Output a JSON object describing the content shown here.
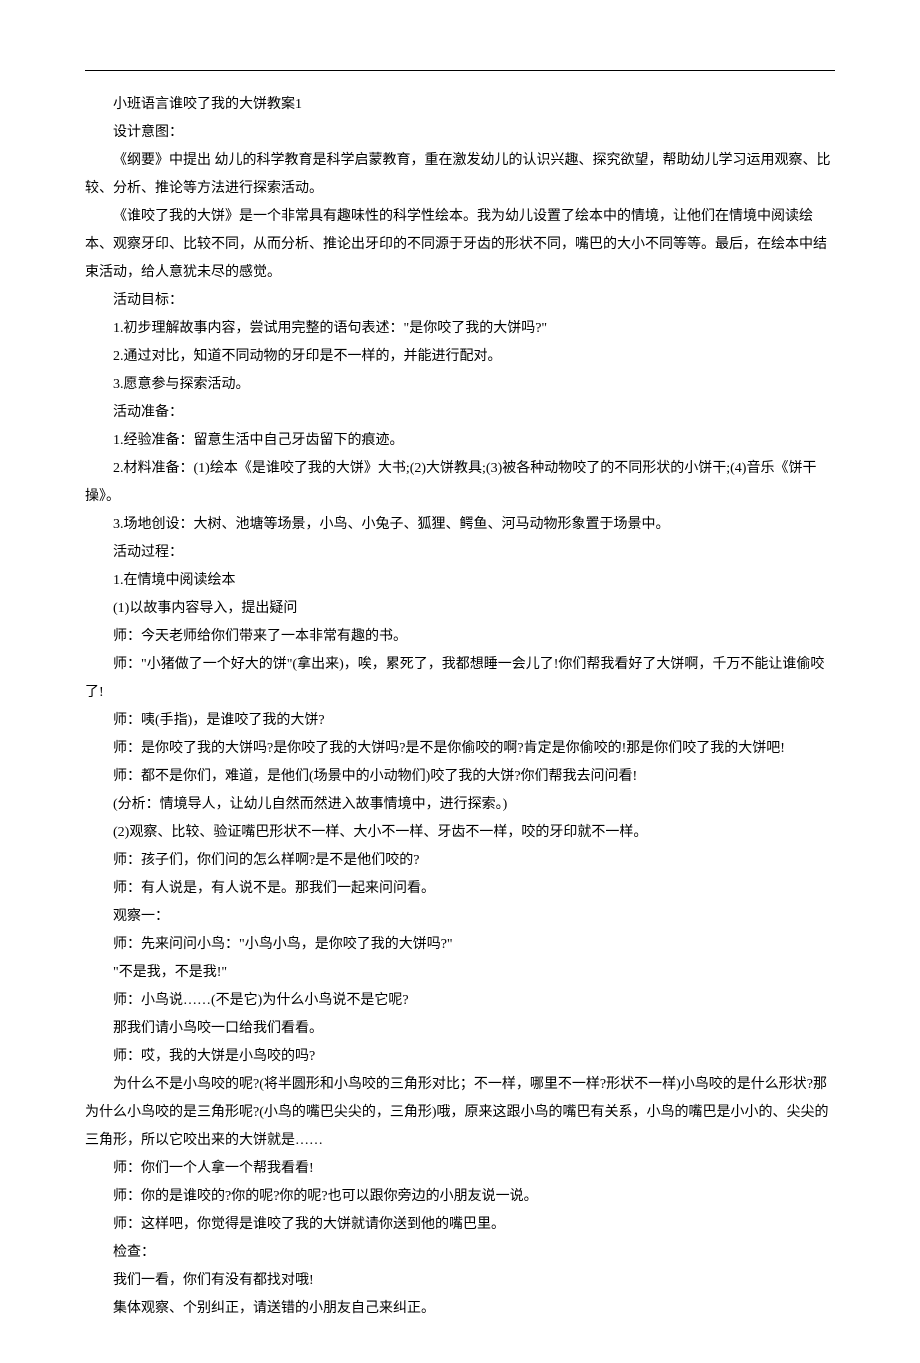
{
  "lines": [
    "小班语言谁咬了我的大饼教案1",
    "设计意图：",
    "《纲要》中提出 幼儿的科学教育是科学启蒙教育，重在激发幼儿的认识兴趣、探究欲望，帮助幼儿学习运用观察、比较、分析、推论等方法进行探索活动。",
    "《谁咬了我的大饼》是一个非常具有趣味性的科学性绘本。我为幼儿设置了绘本中的情境，让他们在情境中阅读绘本、观察牙印、比较不同，从而分析、推论出牙印的不同源于牙齿的形状不同，嘴巴的大小不同等等。最后，在绘本中结束活动，给人意犹未尽的感觉。",
    "活动目标：",
    "1.初步理解故事内容，尝试用完整的语句表述：\"是你咬了我的大饼吗?\"",
    "2.通过对比，知道不同动物的牙印是不一样的，并能进行配对。",
    "3.愿意参与探索活动。",
    "活动准备：",
    "1.经验准备：留意生活中自己牙齿留下的痕迹。",
    "2.材料准备：(1)绘本《是谁咬了我的大饼》大书;(2)大饼教具;(3)被各种动物咬了的不同形状的小饼干;(4)音乐《饼干操》。",
    "3.场地创设：大树、池塘等场景，小鸟、小兔子、狐狸、鳄鱼、河马动物形象置于场景中。",
    "活动过程：",
    "1.在情境中阅读绘本",
    "(1)以故事内容导入，提出疑问",
    "师：今天老师给你们带来了一本非常有趣的书。",
    "师：\"小猪做了一个好大的饼\"(拿出来)，唉，累死了，我都想睡一会儿了!你们帮我看好了大饼啊，千万不能让谁偷咬了!",
    "师：咦(手指)，是谁咬了我的大饼?",
    "师：是你咬了我的大饼吗?是你咬了我的大饼吗?是不是你偷咬的啊?肯定是你偷咬的!那是你们咬了我的大饼吧!",
    "师：都不是你们，难道，是他们(场景中的小动物们)咬了我的大饼?你们帮我去问问看!",
    "(分析：情境导人，让幼儿自然而然进入故事情境中，进行探索。)",
    "(2)观察、比较、验证嘴巴形状不一样、大小不一样、牙齿不一样，咬的牙印就不一样。",
    "师：孩子们，你们问的怎么样啊?是不是他们咬的?",
    "师：有人说是，有人说不是。那我们一起来问问看。",
    "观察一：",
    "师：先来问问小鸟：\"小鸟小鸟，是你咬了我的大饼吗?\"",
    "\"不是我，不是我!\"",
    "师：小鸟说……(不是它)为什么小鸟说不是它呢?",
    "那我们请小鸟咬一口给我们看看。",
    "师：哎，我的大饼是小鸟咬的吗?",
    "为什么不是小鸟咬的呢?(将半圆形和小鸟咬的三角形对比；不一样，哪里不一样?形状不一样)小鸟咬的是什么形状?那为什么小鸟咬的是三角形呢?(小鸟的嘴巴尖尖的，三角形)哦，原来这跟小鸟的嘴巴有关系，小鸟的嘴巴是小小的、尖尖的三角形，所以它咬出来的大饼就是……",
    "师：你们一个人拿一个帮我看看!",
    "师：你的是谁咬的?你的呢?你的呢?也可以跟你旁边的小朋友说一说。",
    "师：这样吧，你觉得是谁咬了我的大饼就请你送到他的嘴巴里。",
    "检查：",
    "我们一看，你们有没有都找对哦!",
    "集体观察、个别纠正，请送错的小朋友自己来纠正。"
  ]
}
